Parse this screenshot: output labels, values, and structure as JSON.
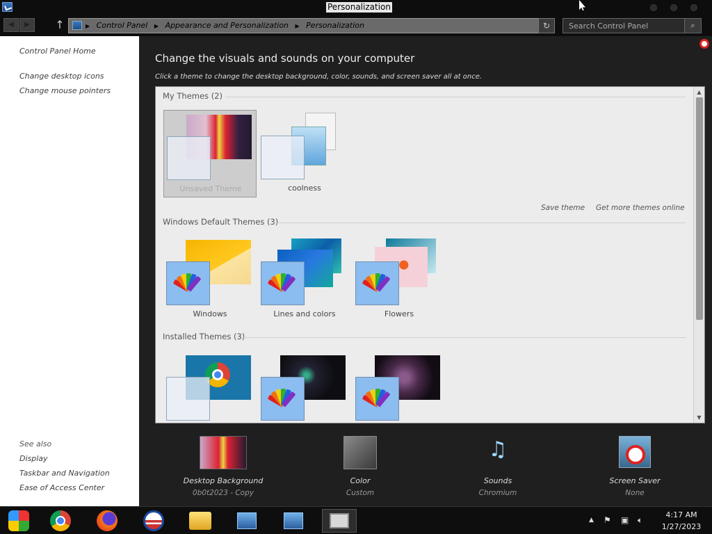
{
  "window": {
    "title": "Personalization"
  },
  "nav": {
    "breadcrumbs": [
      "Control Panel",
      "Appearance and Personalization",
      "Personalization"
    ],
    "search_placeholder": "Search Control Panel"
  },
  "leftnav": {
    "home": "Control Panel Home",
    "links": [
      "Change desktop icons",
      "Change mouse pointers"
    ],
    "see_also_title": "See also",
    "see_also": [
      "Display",
      "Taskbar and Navigation",
      "Ease of Access Center"
    ]
  },
  "main": {
    "heading": "Change the visuals and sounds on your computer",
    "subheading": "Click a theme to change the desktop background, color, sounds, and screen saver all at once.",
    "sections": {
      "my_themes": {
        "title": "My Themes (2)",
        "themes": [
          {
            "label": "Unsaved Theme",
            "selected": true
          },
          {
            "label": "coolness",
            "selected": false
          }
        ],
        "save_link": "Save theme",
        "more_link": "Get more themes online"
      },
      "default_themes": {
        "title": "Windows Default Themes (3)",
        "themes": [
          {
            "label": "Windows"
          },
          {
            "label": "Lines and colors"
          },
          {
            "label": "Flowers"
          }
        ]
      },
      "installed_themes": {
        "title": "Installed Themes (3)"
      }
    }
  },
  "settings": [
    {
      "name": "Desktop Background",
      "value": "0b0t2023 - Copy"
    },
    {
      "name": "Color",
      "value": "Custom"
    },
    {
      "name": "Sounds",
      "value": "Chromium"
    },
    {
      "name": "Screen Saver",
      "value": "None"
    }
  ],
  "taskbar": {
    "time": "4:17 AM",
    "date": "1/27/2023"
  }
}
